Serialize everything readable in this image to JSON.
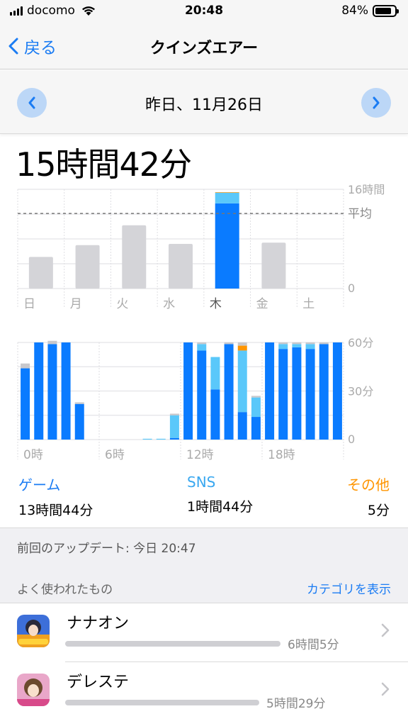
{
  "status": {
    "carrier": "docomo",
    "time": "20:48",
    "battery": "84%",
    "battery_level": 0.84
  },
  "nav": {
    "back_label": "戻る",
    "title": "クインズエアー"
  },
  "date": {
    "label": "昨日、11月26日"
  },
  "total": "15時間42分",
  "colors": {
    "accent": "#1b7cf3",
    "game": "#0a7bff",
    "sns": "#5ac8fa",
    "other": "#ff9500",
    "gray": "#d4d4d8"
  },
  "chart_data": [
    {
      "type": "bar",
      "categories": [
        "日",
        "月",
        "火",
        "水",
        "木",
        "金",
        "土"
      ],
      "ylim": [
        0,
        16
      ],
      "y_unit": "時間",
      "yticks": [
        "16時間",
        "0"
      ],
      "average_label": "平均",
      "average": 12.1,
      "values": [
        5.1,
        7.0,
        10.2,
        7.2,
        15.7,
        7.4,
        0
      ],
      "highlight_index": 4,
      "highlight_series": [
        {
          "name": "ゲーム",
          "value": 13.73
        },
        {
          "name": "SNS",
          "value": 1.73
        },
        {
          "name": "その他",
          "value": 0.08
        }
      ]
    },
    {
      "type": "bar",
      "stacked": true,
      "x": [
        0,
        1,
        2,
        3,
        4,
        5,
        6,
        7,
        8,
        9,
        10,
        11,
        12,
        13,
        14,
        15,
        16,
        17,
        18,
        19,
        20,
        21,
        22,
        23
      ],
      "xticks": [
        "0時",
        "6時",
        "12時",
        "18時"
      ],
      "ylim": [
        0,
        60
      ],
      "yticks": [
        "60分",
        "30分",
        "0"
      ],
      "series": [
        {
          "name": "ゲーム",
          "values": [
            44,
            60,
            59,
            60,
            22,
            0,
            0,
            0,
            0,
            0,
            0,
            1,
            60,
            55,
            31,
            59,
            17,
            14,
            60,
            56,
            57,
            56,
            59,
            60
          ]
        },
        {
          "name": "SNS",
          "values": [
            0,
            0,
            0,
            0,
            0,
            0,
            0,
            0,
            0,
            0.5,
            0.5,
            14,
            0,
            4,
            20,
            0,
            38,
            12,
            0,
            3,
            2,
            3,
            0,
            0
          ]
        },
        {
          "name": "その他",
          "values": [
            0,
            0,
            0,
            0,
            0,
            0,
            0,
            0,
            0,
            0,
            0,
            0,
            0,
            0,
            0,
            0,
            3,
            0,
            0,
            0,
            0,
            0,
            0,
            0
          ]
        },
        {
          "name": "",
          "values": [
            3,
            0,
            2,
            0,
            1,
            0,
            0,
            0,
            0,
            0,
            0,
            1,
            0,
            1,
            0,
            1,
            2,
            1,
            0,
            1,
            1,
            1,
            1,
            0
          ]
        }
      ]
    }
  ],
  "categories": [
    {
      "name": "ゲーム",
      "value": "13時間44分"
    },
    {
      "name": "SNS",
      "value": "1時間44分"
    },
    {
      "name": "その他",
      "value": "5分"
    }
  ],
  "updated": "前回のアップデート: 今日 20:47",
  "most_used": {
    "heading": "よく使われたもの",
    "show_categories": "カテゴリを表示"
  },
  "apps": [
    {
      "name": "ナナオン",
      "duration": "6時間5分",
      "minutes": 365
    },
    {
      "name": "デレステ",
      "duration": "5時間29分",
      "minutes": 329
    }
  ]
}
